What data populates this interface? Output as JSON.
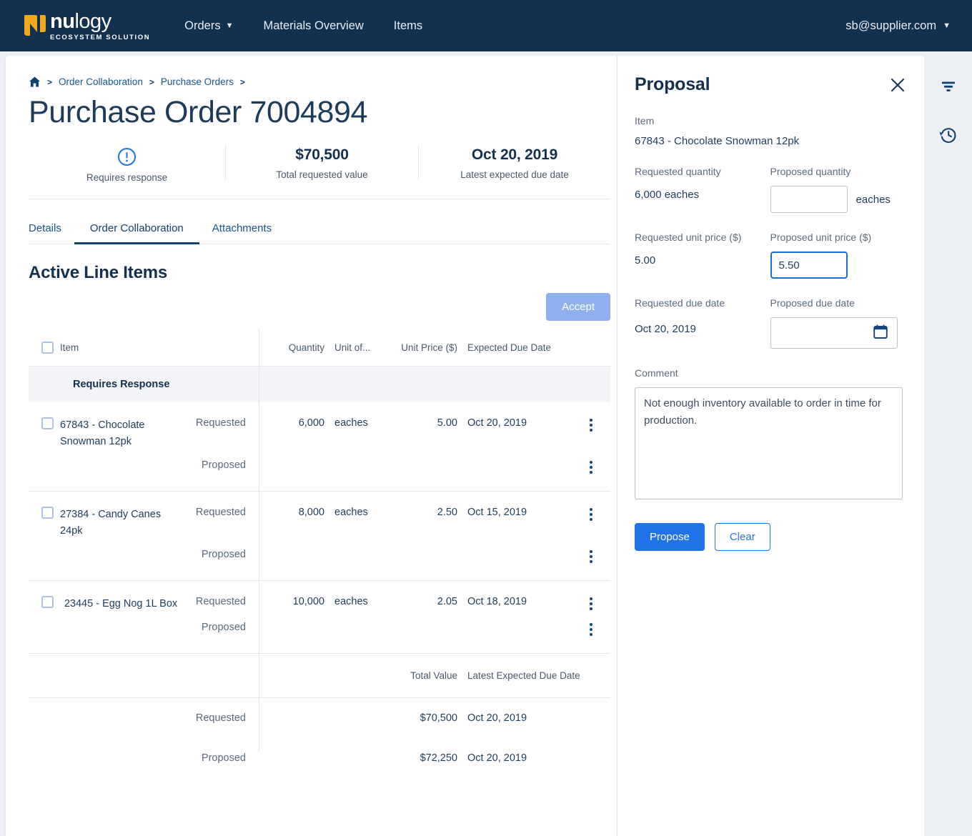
{
  "nav": {
    "brand": {
      "word_bold": "nu",
      "word_light": "logy",
      "tagline": "ECOSYSTEM SOLUTION",
      "logo_color": "#f0a81e"
    },
    "links": [
      {
        "label": "Orders",
        "has_caret": true
      },
      {
        "label": "Materials Overview",
        "has_caret": false
      },
      {
        "label": "Items",
        "has_caret": false
      }
    ],
    "user": {
      "label": "sb@supplier.com",
      "has_caret": true
    },
    "bg_color": "#12304f"
  },
  "breadcrumb": {
    "home_icon": "home-icon",
    "sep": ">",
    "items": [
      {
        "label": "Order Collaboration"
      },
      {
        "label": "Purchase Orders"
      }
    ]
  },
  "page": {
    "title": "Purchase Order 7004894"
  },
  "summary": {
    "cells": [
      {
        "icon": "alert-circle-icon",
        "value": "",
        "label": "Requires response"
      },
      {
        "icon": "",
        "value": "$70,500",
        "label": "Total requested value"
      },
      {
        "icon": "",
        "value": "Oct 20, 2019",
        "label": "Latest expected due date"
      }
    ]
  },
  "tabs": [
    {
      "label": "Details",
      "active": false
    },
    {
      "label": "Order Collaboration",
      "active": true
    },
    {
      "label": "Attachments",
      "active": false
    }
  ],
  "section": {
    "title": "Active Line Items",
    "accept_label": "Accept"
  },
  "table": {
    "headers": {
      "item": "Item",
      "quantity": "Quantity",
      "uom": "Unit of...",
      "unit_price": "Unit Price ($)",
      "due_date": "Expected Due Date"
    },
    "group_label": "Requires Response",
    "row_labels": {
      "requested": "Requested",
      "proposed": "Proposed"
    },
    "rows": [
      {
        "item": "67843 - Chocolate Snowman 12pk",
        "requested": {
          "quantity": "6,000",
          "uom": "eaches",
          "unit_price": "5.00",
          "due_date": "Oct 20, 2019"
        },
        "proposed": {
          "quantity": "",
          "uom": "",
          "unit_price": "",
          "due_date": ""
        }
      },
      {
        "item": "27384 - Candy Canes 24pk",
        "requested": {
          "quantity": "8,000",
          "uom": "eaches",
          "unit_price": "2.50",
          "due_date": "Oct 15, 2019"
        },
        "proposed": {
          "quantity": "",
          "uom": "",
          "unit_price": "",
          "due_date": ""
        }
      },
      {
        "item": "23445 - Egg Nog 1L Box",
        "requested": {
          "quantity": "10,000",
          "uom": "eaches",
          "unit_price": "2.05",
          "due_date": "Oct 18, 2019"
        },
        "proposed": {
          "quantity": "",
          "uom": "",
          "unit_price": "",
          "due_date": ""
        }
      }
    ],
    "totals": {
      "header_total_value": "Total Value",
      "header_latest_due": "Latest Expected Due Date",
      "requested": {
        "label": "Requested",
        "total_value": "$70,500",
        "latest_due": "Oct 20, 2019"
      },
      "proposed": {
        "label": "Proposed",
        "total_value": "$72,250",
        "latest_due": "Oct 20, 2019"
      }
    }
  },
  "proposal": {
    "title": "Proposal",
    "close_icon": "close-icon",
    "item_label": "Item",
    "item_value": "67843 - Chocolate Snowman 12pk",
    "requested_quantity_label": "Requested quantity",
    "requested_quantity_value": "6,000 eaches",
    "proposed_quantity_label": "Proposed quantity",
    "proposed_quantity_value": "",
    "proposed_quantity_unit": "eaches",
    "requested_unit_price_label": "Requested unit price ($)",
    "requested_unit_price_value": "5.00",
    "proposed_unit_price_label": "Proposed unit price ($)",
    "proposed_unit_price_value": "5.50",
    "requested_due_date_label": "Requested due date",
    "requested_due_date_value": "Oct 20, 2019",
    "proposed_due_date_label": "Proposed due date",
    "proposed_due_date_value": "",
    "comment_label": "Comment",
    "comment_value": "Not enough inventory available to order in time for production.",
    "propose_label": "Propose",
    "clear_label": "Clear",
    "accent_color": "#2173e8"
  },
  "rail": {
    "icons": [
      {
        "name": "filter-icon"
      },
      {
        "name": "history-icon"
      }
    ]
  }
}
